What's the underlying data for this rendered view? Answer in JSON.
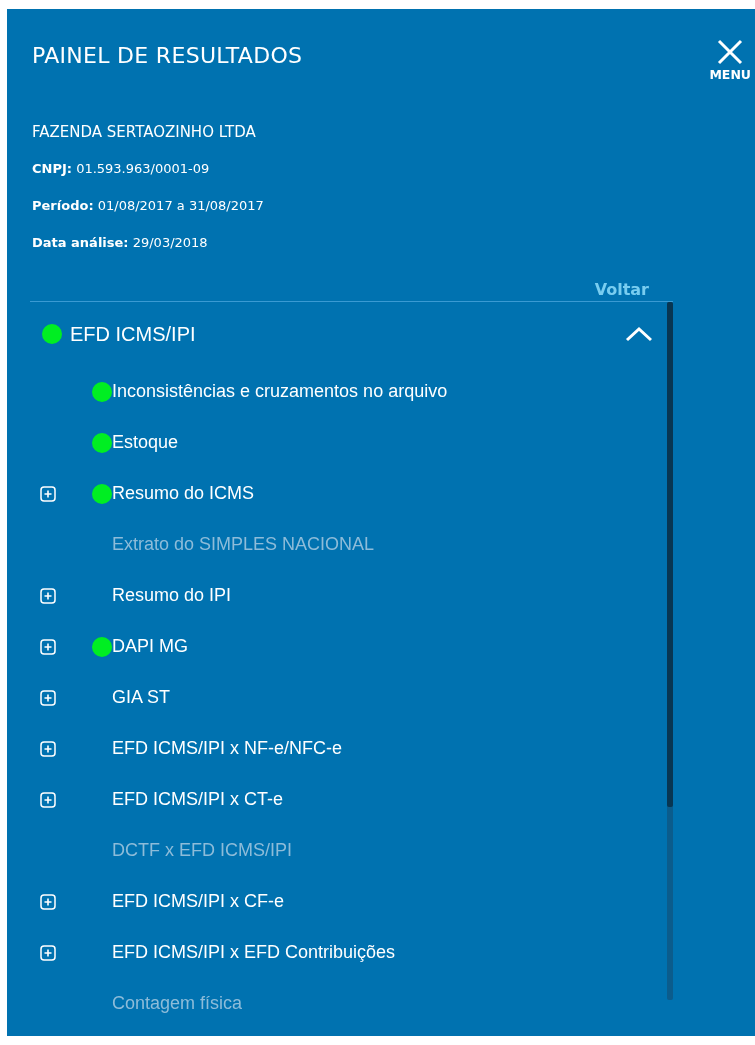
{
  "panel": {
    "title": "PAINEL DE RESULTADOS",
    "menu_button": {
      "label": "MENU"
    }
  },
  "company": {
    "name": "FAZENDA SERTAOZINHO LTDA",
    "fields": [
      {
        "label": "CNPJ:",
        "value": "01.593.963/0001-09"
      },
      {
        "label": "Período:",
        "value": "01/08/2017 a 31/08/2017"
      },
      {
        "label": "Data análise:",
        "value": "29/03/2018"
      }
    ]
  },
  "back_link": "Voltar",
  "section": {
    "label": "EFD ICMS/IPI",
    "status_dot": true,
    "expanded": true,
    "items": [
      {
        "label": "Inconsistências e cruzamentos no arquivo",
        "expandable": false,
        "status_dot": true,
        "disabled": false
      },
      {
        "label": "Estoque",
        "expandable": false,
        "status_dot": true,
        "disabled": false
      },
      {
        "label": "Resumo do ICMS",
        "expandable": true,
        "status_dot": true,
        "disabled": false
      },
      {
        "label": "Extrato do SIMPLES NACIONAL",
        "expandable": false,
        "status_dot": false,
        "disabled": true
      },
      {
        "label": "Resumo do IPI",
        "expandable": true,
        "status_dot": false,
        "disabled": false
      },
      {
        "label": "DAPI MG",
        "expandable": true,
        "status_dot": true,
        "disabled": false
      },
      {
        "label": "GIA ST",
        "expandable": true,
        "status_dot": false,
        "disabled": false
      },
      {
        "label": "EFD ICMS/IPI x NF-e/NFC-e",
        "expandable": true,
        "status_dot": false,
        "disabled": false
      },
      {
        "label": "EFD ICMS/IPI x CT-e",
        "expandable": true,
        "status_dot": false,
        "disabled": false
      },
      {
        "label": "DCTF x EFD ICMS/IPI",
        "expandable": false,
        "status_dot": false,
        "disabled": true
      },
      {
        "label": "EFD ICMS/IPI x CF-e",
        "expandable": true,
        "status_dot": false,
        "disabled": false
      },
      {
        "label": "EFD ICMS/IPI x EFD Contribuições",
        "expandable": true,
        "status_dot": false,
        "disabled": false
      },
      {
        "label": "Contagem física",
        "expandable": false,
        "status_dot": false,
        "disabled": true
      }
    ]
  }
}
